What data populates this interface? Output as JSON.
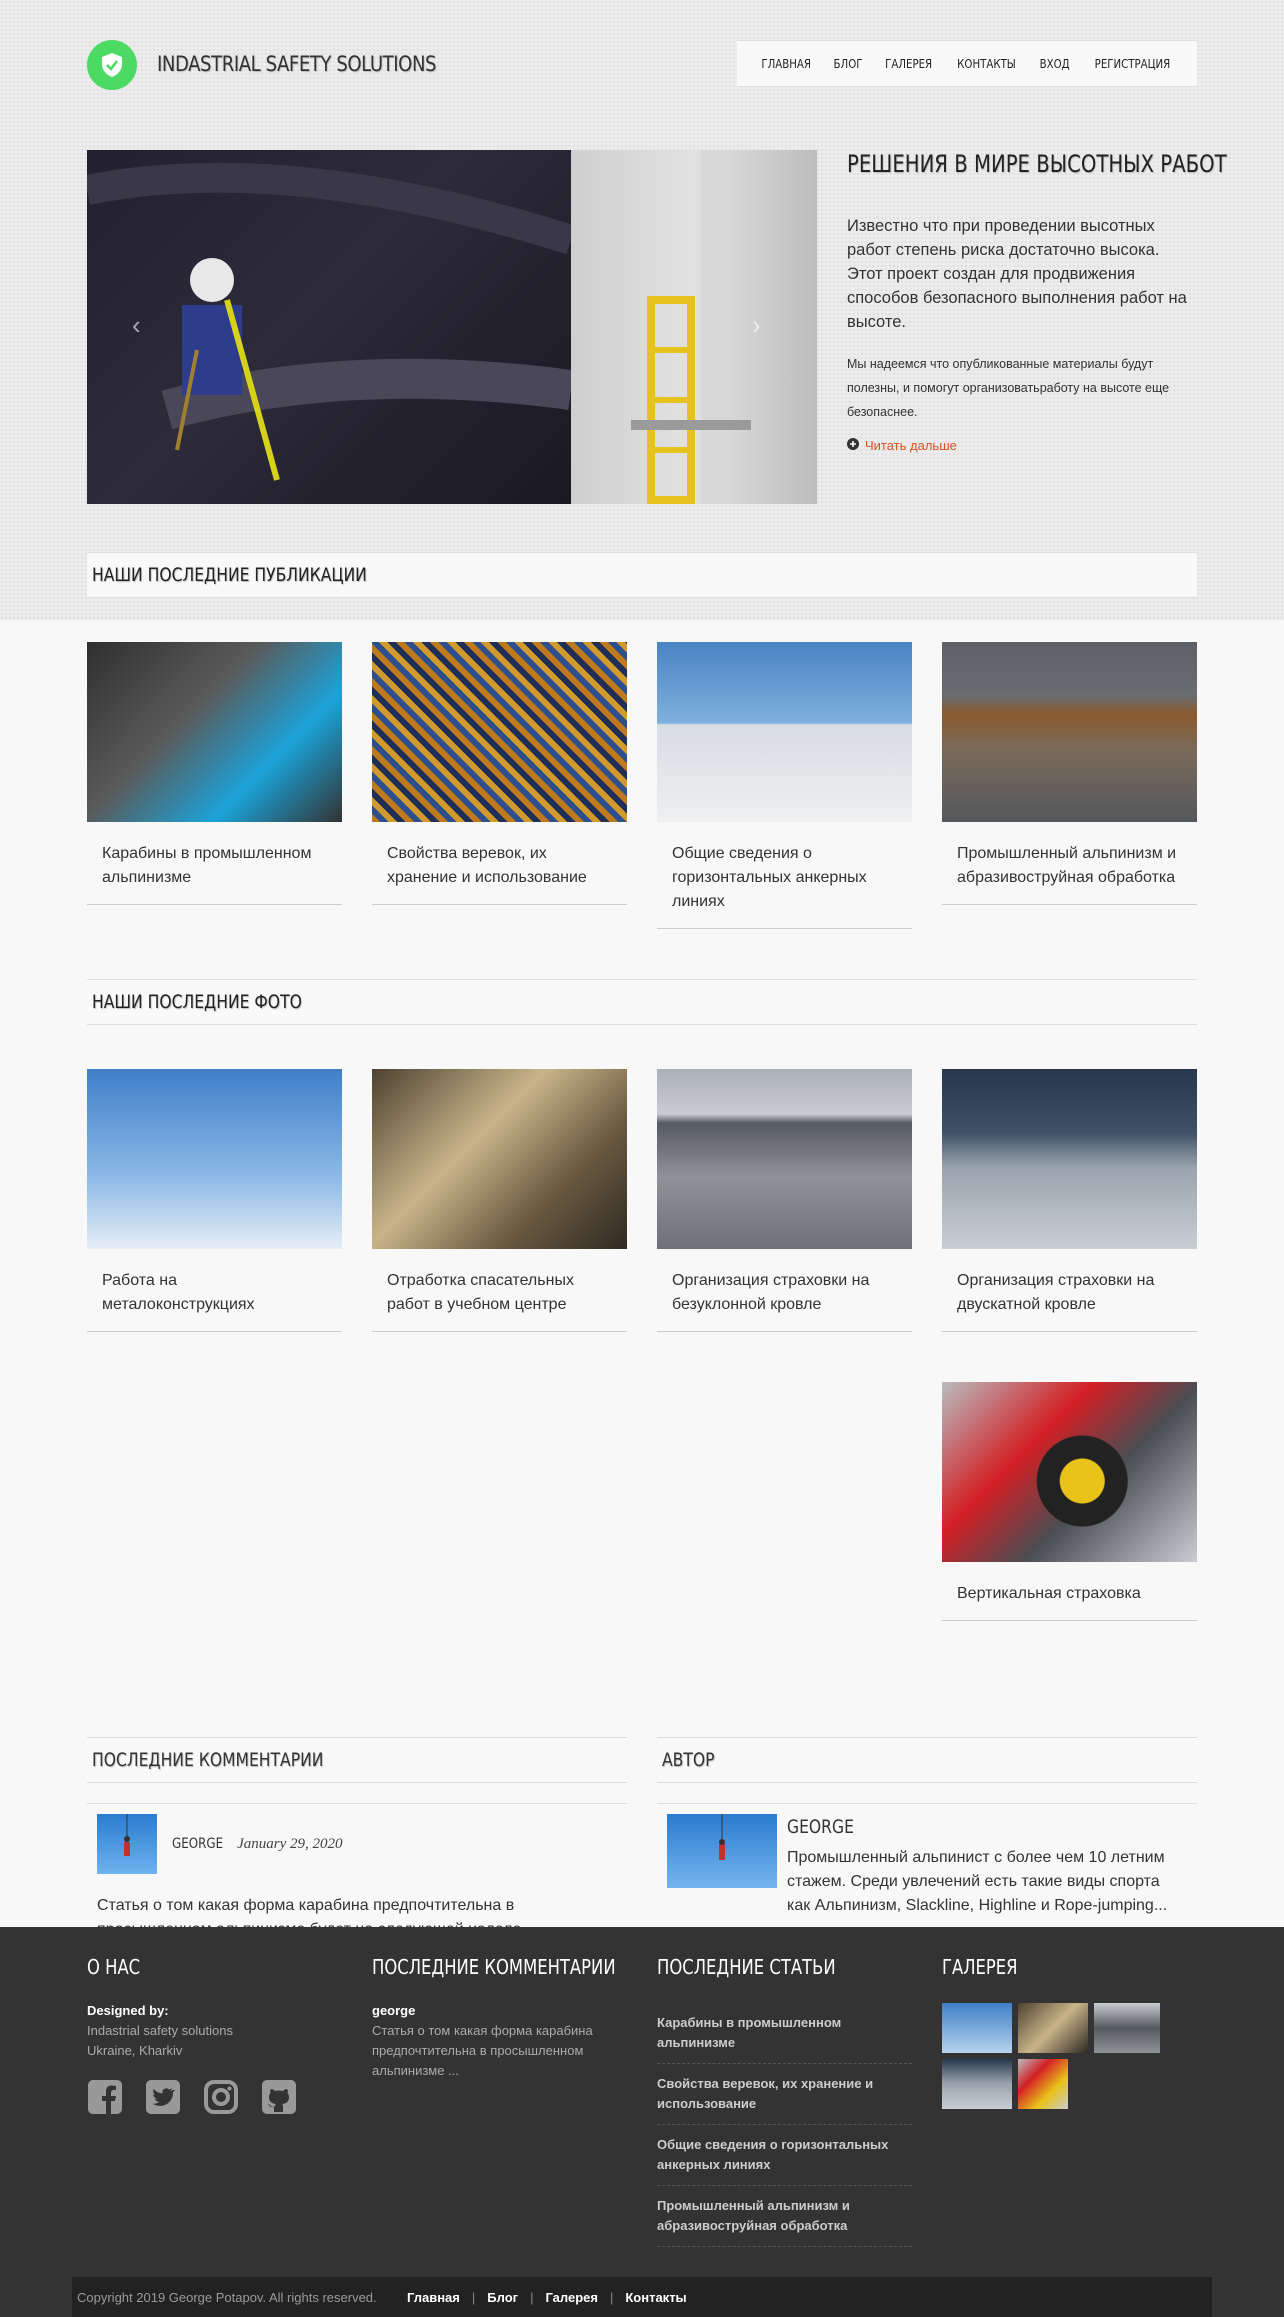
{
  "header": {
    "site_title": "INDASTRIAL SAFETY SOLUTIONS",
    "nav": [
      "ГЛАВНАЯ",
      "БЛОГ",
      "ГАЛЕРЕЯ",
      "КОНТАКТЫ",
      "ВХОД",
      "РЕГИСТРАЦИЯ"
    ]
  },
  "intro": {
    "title": "РЕШЕНИЯ В МИРЕ ВЫСОТНЫХ РАБОТ",
    "lead": "Известно что при проведении высотных работ степень риска достаточно высока. Этот проект создан для продвижения способов безопасного выполнения работ на высоте.",
    "small": "Мы надеемся что опубликованные материалы будут полезны, и помогут организоватьработу на высоте еще безопаснее.",
    "more": "Читать дальше"
  },
  "publications": {
    "heading": "НАШИ ПОСЛЕДНИЕ ПУБЛИКАЦИИ",
    "items": [
      "Карабины в промышленном альпинизме",
      "Свойства веревок, их хранение и использование",
      "Общие сведения о горизонтальных анкерных линиях",
      "Промышленный альпинизм и абразивоструйная обработка"
    ]
  },
  "photos": {
    "heading": "НАШИ ПОСЛЕДНИЕ ФОТО",
    "items": [
      "Работа на металоконструкциях",
      "Отработка спасательных работ в учебном центре",
      "Организация страховки на безуклонной кровле",
      "Организация страховки на двускатной кровле",
      "Вертикальная страховка"
    ]
  },
  "comments": {
    "heading": "ПОСЛЕДНИЕ КОММЕНТАРИИ",
    "author": "GEORGE",
    "date": "January 29, 2020",
    "text": "Статья о том какая форма карабина предпочтительна в просышленном альпинизме будет на следующей неделе."
  },
  "author": {
    "heading": "АВТОР",
    "name": "GEORGE",
    "bio": "Промышленный альпинист с более чем 10 летним стажем. Среди увлечений есть такие виды спорта как Альпинизм, Slackline, Highline и Rope-jumping..."
  },
  "footer": {
    "about": {
      "heading": "О НАС",
      "designed_label": "Designed by:",
      "line1": "Indastrial safety solutions",
      "line2": "Ukraine, Kharkiv"
    },
    "recent_comments": {
      "heading": "ПОСЛЕДНИЕ КОММЕНТАРИИ",
      "author": "george",
      "text": "Статья о том какая форма карабина предпочтительна в просышленном альпинизме ..."
    },
    "recent_articles": {
      "heading": "ПОСЛЕДНИЕ СТАТЬИ",
      "items": [
        "Карабины в промышленном альпинизме",
        "Свойства веревок, их хранение и использование",
        "Общие сведения о горизонтальных анкерных линиях",
        "Промышленный альпинизм и абразивоструйная обработка"
      ]
    },
    "gallery": {
      "heading": "ГАЛЕРЕЯ"
    },
    "social_icons": [
      "facebook-icon",
      "twitter-icon",
      "instagram-icon",
      "github-icon"
    ]
  },
  "bottom_bar": {
    "copyright": "Copyright 2019 George Potapov. All rights reserved.",
    "links": [
      "Главная",
      "Блог",
      "Галерея",
      "Контакты"
    ]
  },
  "colors": {
    "accent_green": "#4cd964",
    "link_orange": "#d9531e",
    "footer_bg": "#333333"
  }
}
